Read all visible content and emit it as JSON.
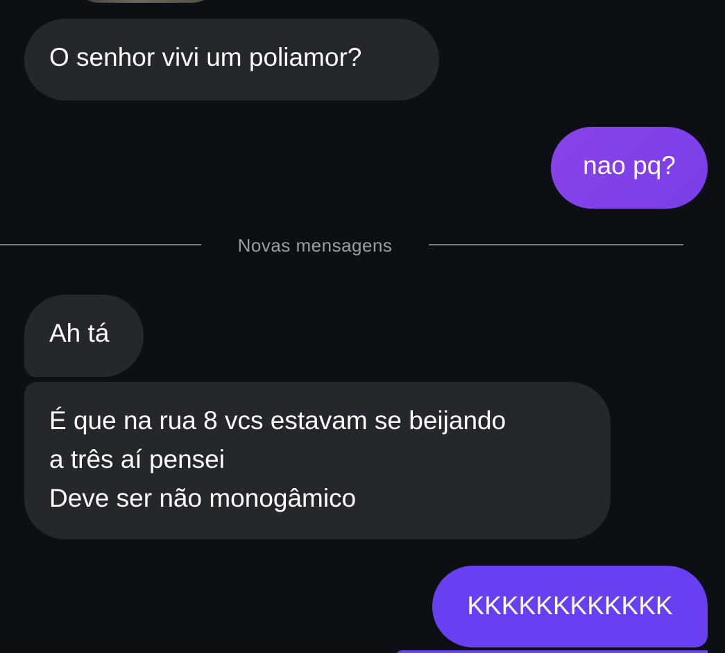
{
  "messages": [
    {
      "direction": "received",
      "text": "O senhor vivi um poliamor?"
    },
    {
      "direction": "sent",
      "text": "nao pq?"
    },
    {
      "direction": "received",
      "text": "Ah tá"
    },
    {
      "direction": "received",
      "text": "É que na rua 8 vcs estavam se beijando\na três aí pensei\nDeve ser não monogâmico"
    },
    {
      "direction": "sent",
      "text": "KKKKKKKKKKKK"
    }
  ],
  "divider": {
    "label": "Novas mensagens"
  },
  "colors": {
    "background": "#0c0f14",
    "received_bubble": "#24272c",
    "sent_bubble_gradient_start": "#8a42ea",
    "sent_bubble_latest": "#6840f2",
    "divider_text": "#9a9ca3"
  }
}
